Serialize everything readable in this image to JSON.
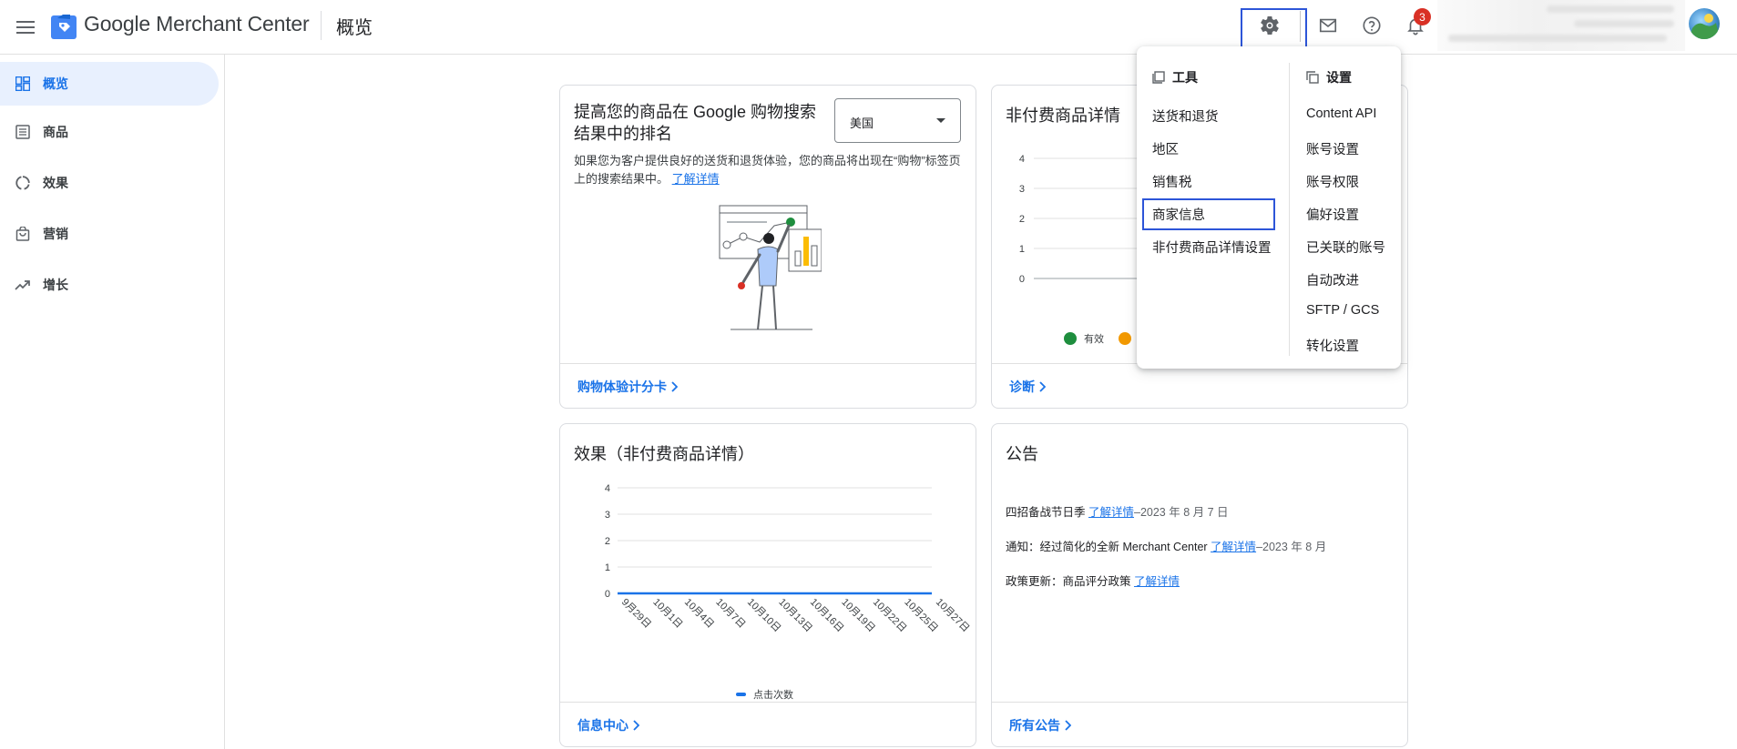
{
  "header": {
    "app_name": "Google Merchant Center",
    "page_title": "概览",
    "notification_count": "3"
  },
  "sidebar": {
    "items": [
      {
        "label": "概览",
        "icon": "dashboard-icon",
        "active": true
      },
      {
        "label": "商品",
        "icon": "list-icon",
        "active": false
      },
      {
        "label": "效果",
        "icon": "donut-icon",
        "active": false
      },
      {
        "label": "营销",
        "icon": "bag-icon",
        "active": false
      },
      {
        "label": "增长",
        "icon": "trending-up-icon",
        "active": false
      }
    ]
  },
  "ranking_card": {
    "title": "提高您的商品在 Google 购物搜索结果中的排名",
    "country_select": "美国",
    "description": "如果您为客户提供良好的送货和退货体验，您的商品将出现在“购物”标签页上的搜索结果中。",
    "learn_more": "了解详情",
    "footer_link": "购物体验计分卡"
  },
  "listings_card": {
    "title": "非付费商品详情",
    "y_ticks": [
      "4",
      "3",
      "2",
      "1",
      "0"
    ],
    "legend_valid": "有效",
    "footer_link": "诊断"
  },
  "performance_card": {
    "title": "效果（非付费商品详情）",
    "legend": "点击次数",
    "footer_link": "信息中心"
  },
  "announcements_card": {
    "title": "公告",
    "items": [
      {
        "text": "四招备战节日季 ",
        "link": "了解详情",
        "date": "–2023 年 8 月 7 日"
      },
      {
        "text": "通知：经过简化的全新 Merchant Center ",
        "link": "了解详情",
        "date": "–2023 年 8 月"
      },
      {
        "text": "政策更新：商品评分政策 ",
        "link": "了解详情",
        "date": ""
      }
    ],
    "footer_link": "所有公告"
  },
  "settings_menu": {
    "tools_heading": "工具",
    "tools_items": [
      "送货和退货",
      "地区",
      "销售税",
      "商家信息",
      "非付费商品详情设置"
    ],
    "settings_heading": "设置",
    "settings_items": [
      "Content API",
      "账号设置",
      "账号权限",
      "偏好设置",
      "已关联的账号",
      "自动改进",
      "SFTP / GCS",
      "转化设置"
    ],
    "highlighted_item": "商家信息"
  },
  "colors": {
    "accent": "#1a73e8",
    "highlight_border": "#2d55d8",
    "badge": "#d93025",
    "valid_green": "#1e8e3e",
    "orange": "#f29900"
  },
  "chart_data": [
    {
      "type": "line",
      "title": "效果（非付费商品详情）",
      "x": [
        "9月29日",
        "10月1日",
        "10月4日",
        "10月7日",
        "10月10日",
        "10月13日",
        "10月16日",
        "10月19日",
        "10月22日",
        "10月25日",
        "10月27日"
      ],
      "series": [
        {
          "name": "点击次数",
          "values": [
            0,
            0,
            0,
            0,
            0,
            0,
            0,
            0,
            0,
            0,
            0
          ]
        }
      ],
      "y_ticks": [
        0,
        1,
        2,
        3,
        4
      ],
      "ylim": [
        0,
        4
      ],
      "grid": true,
      "legend": "bottom"
    }
  ]
}
